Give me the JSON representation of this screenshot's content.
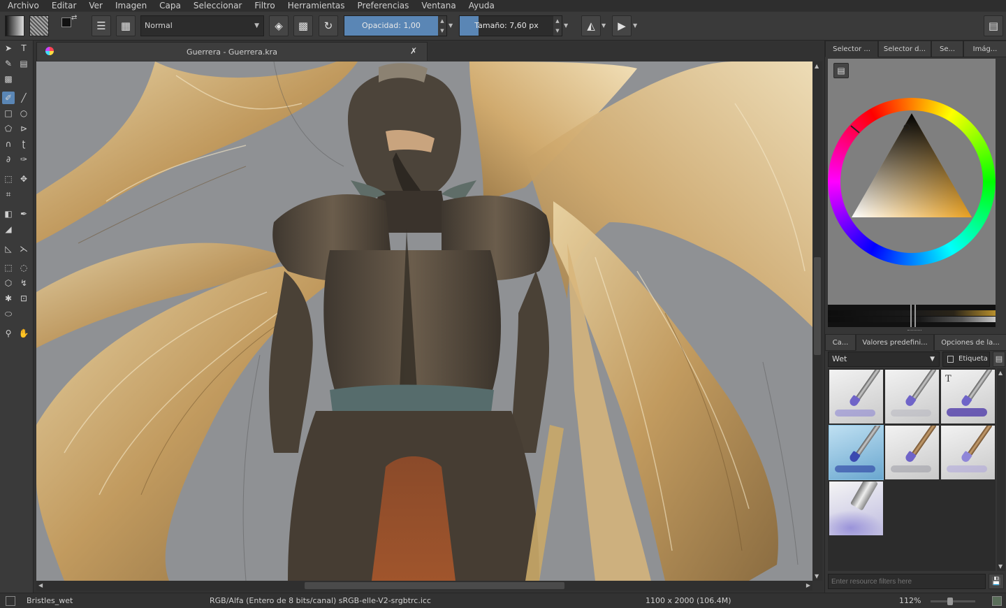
{
  "menu": [
    "Archivo",
    "Editar",
    "Ver",
    "Imagen",
    "Capa",
    "Seleccionar",
    "Filtro",
    "Herramientas",
    "Preferencias",
    "Ventana",
    "Ayuda"
  ],
  "toolbar": {
    "blend_mode": "Normal",
    "opacity_label": "Opacidad:  1,00",
    "opacity_value": 1.0,
    "size_label": "Tamaño:  7,60 px",
    "size_fill": 0.18
  },
  "document": {
    "tab_title": "Guerrera - Guerrera.kra",
    "close_glyph": "✗"
  },
  "docker_top": {
    "tabs": [
      "Selector ...",
      "Selector d...",
      "Se...",
      "Imág..."
    ],
    "active_tab": 0
  },
  "docker_presets": {
    "tabs": [
      "Ca...",
      "Valores predefini...",
      "Opciones de la..."
    ],
    "active_tab": 1,
    "preset_combo": "Wet",
    "tag_label": "Etiqueta",
    "filter_placeholder": "Enter resource filters here"
  },
  "colors": {
    "accent": "#5a86b5",
    "selected_hue": "#e8a020"
  },
  "status": {
    "brush": "Bristles_wet",
    "color_space": "RGB/Alfa (Entero de 8 bits/canal)  sRGB-elle-V2-srgbtrc.icc",
    "dimensions": "1100 x 2000 (106.4M)",
    "zoom": "112%"
  }
}
